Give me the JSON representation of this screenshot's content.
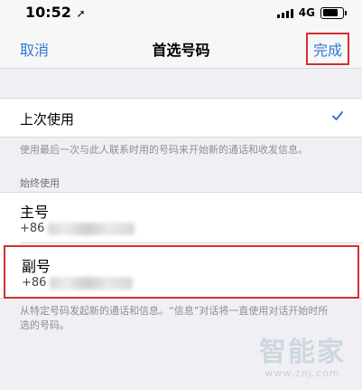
{
  "status_bar": {
    "time": "10:52",
    "location_glyph": "➚",
    "network": "4G"
  },
  "nav": {
    "cancel_label": "取消",
    "title": "首选号码",
    "done_label": "完成"
  },
  "recent": {
    "label": "上次使用",
    "selected": true,
    "footnote": "使用最后一次与此人联系时用的号码来开始新的通话和收发信息。"
  },
  "always": {
    "header": "始终使用",
    "phones": [
      {
        "label": "主号",
        "number_prefix": "+86"
      },
      {
        "label": "副号",
        "number_prefix": "+86"
      }
    ],
    "footnote": "从特定号码发起新的通话和信息。“信息”对话将一直使用对话开始时所选的号码。"
  },
  "watermark": {
    "logo": "智能家",
    "url": "www.znj.com"
  },
  "colors": {
    "accent": "#2f7ad6",
    "highlight_box": "#d32f2f",
    "background": "#efeff4"
  }
}
